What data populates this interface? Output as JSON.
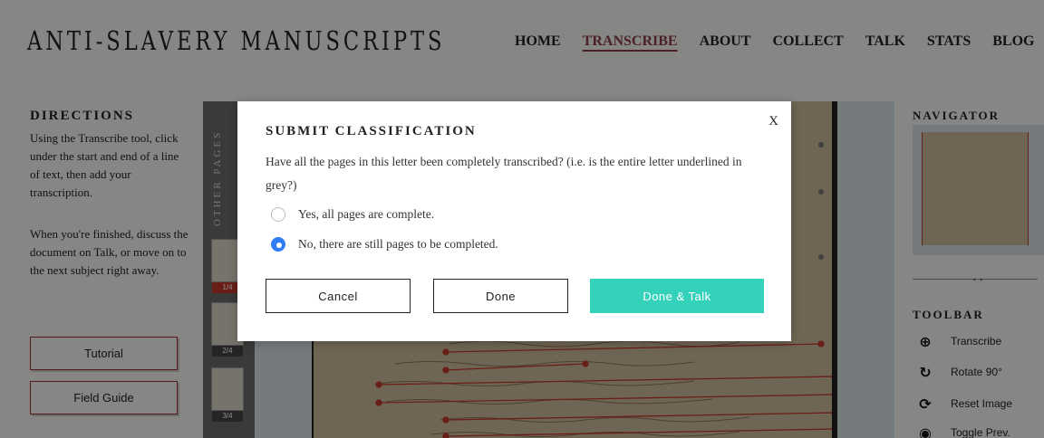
{
  "header": {
    "site_title": "ANTI-SLAVERY MANUSCRIPTS",
    "nav": [
      "HOME",
      "TRANSCRIBE",
      "ABOUT",
      "COLLECT",
      "TALK",
      "STATS",
      "BLOG"
    ],
    "active_nav": "TRANSCRIBE"
  },
  "directions": {
    "heading": "DIRECTIONS",
    "paragraph1": "Using the Transcribe tool, click under the start and end of a line of text, then add your transcription.",
    "paragraph2": "When you're finished, discuss the document on Talk, or move on to the next subject right away.",
    "tutorial_label": "Tutorial",
    "field_guide_label": "Field Guide"
  },
  "other_pages": {
    "label": "OTHER PAGES",
    "pages": [
      "1/4",
      "2/4",
      "3/4"
    ],
    "active_page": "1/4"
  },
  "navigator": {
    "heading": "NAVIGATOR"
  },
  "toolbar": {
    "heading": "TOOLBAR",
    "tools": [
      {
        "icon": "plus-circle-icon",
        "label": "Transcribe"
      },
      {
        "icon": "rotate-icon",
        "label": "Rotate 90°"
      },
      {
        "icon": "reset-icon",
        "label": "Reset Image"
      },
      {
        "icon": "eye-icon",
        "label": "Toggle Prev."
      }
    ]
  },
  "modal": {
    "close_label": "X",
    "title": "SUBMIT CLASSIFICATION",
    "question": "Have all the pages in this letter been completely transcribed? (i.e. is the entire letter underlined in grey?)",
    "options": [
      {
        "label": "Yes, all pages are complete.",
        "checked": false
      },
      {
        "label": "No, there are still pages to be completed.",
        "checked": true
      }
    ],
    "cancel_label": "Cancel",
    "done_label": "Done",
    "done_talk_label": "Done & Talk"
  },
  "colors": {
    "accent_teal": "#35d2bb",
    "radio_blue": "#2f7cf6",
    "button_border_red": "#9b2c32",
    "annotation_red": "#c0392b"
  }
}
